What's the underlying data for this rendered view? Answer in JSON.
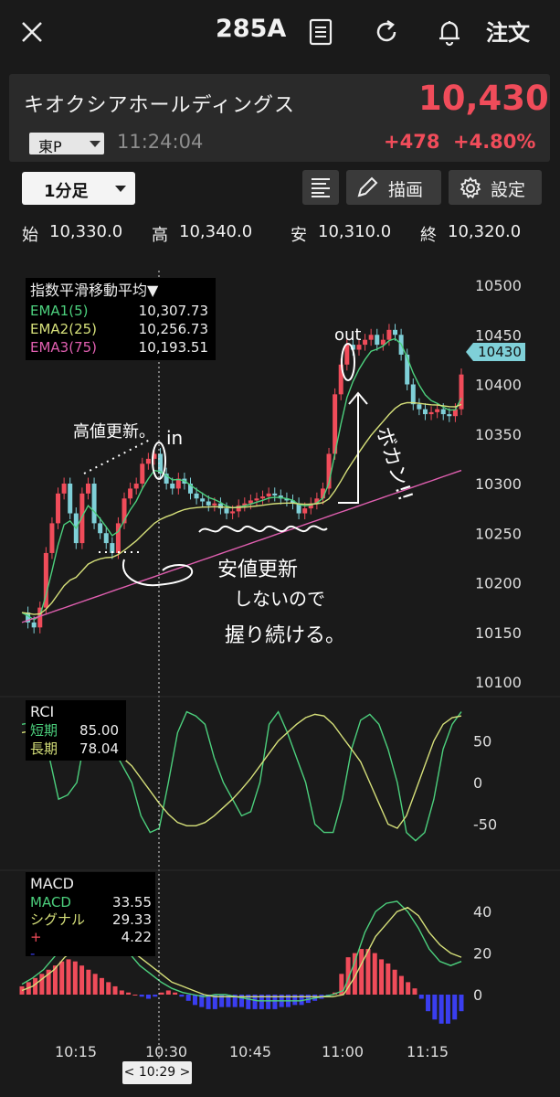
{
  "header": {
    "ticker": "285A",
    "order_label": "注文"
  },
  "quote": {
    "company_name": "キオクシアホールディングス",
    "price": "10,430",
    "market": "東P",
    "time": "11:24:04",
    "change": "+478",
    "change_pct": "+4.80%",
    "up_color": "#f04c5a"
  },
  "toolbar": {
    "period": "1分足",
    "draw_label": "描画",
    "settings_label": "設定"
  },
  "ohlc": {
    "open_label": "始",
    "open": "10,330.0",
    "high_label": "高",
    "high": "10,340.0",
    "low_label": "安",
    "low": "10,310.0",
    "close_label": "終",
    "close": "10,320.0"
  },
  "indicators": {
    "ema_title": "指数平滑移動平均▼",
    "ema1_label": "EMA1(5)",
    "ema1_value": "10,307.73",
    "ema2_label": "EMA2(25)",
    "ema2_value": "10,256.73",
    "ema3_label": "EMA3(75)",
    "ema3_value": "10,193.51",
    "rci_title": "RCI",
    "rci_short_label": "短期",
    "rci_short_value": "85.00",
    "rci_long_label": "長期",
    "rci_long_value": "78.04",
    "macd_title": "MACD",
    "macd_label": "MACD",
    "macd_value": "33.55",
    "signal_label": "シグナル",
    "signal_value": "29.33",
    "hist_plus_label": "+",
    "hist_value": "4.22",
    "hist_minus_label": "-"
  },
  "price_axis": {
    "ticks": [
      "10500",
      "10450",
      "10400",
      "10350",
      "10300",
      "10250",
      "10200",
      "10150",
      "10100"
    ],
    "current_tag": "10430"
  },
  "rci_axis": {
    "ticks": [
      "50",
      "0",
      "-50"
    ]
  },
  "macd_axis": {
    "ticks": [
      "40",
      "20",
      "0"
    ]
  },
  "time_axis": {
    "ticks": [
      "10:15",
      "10:30",
      "10:45",
      "11:00",
      "11:15"
    ],
    "cursor_label": "< 10:29 >"
  },
  "annotations": {
    "high_update": "高値更新。",
    "in": "in",
    "out": "out",
    "bokan": "ボカン!!",
    "note_line1": "安値更新",
    "note_line2": "しないので",
    "note_line3": "握り続ける。"
  },
  "colors": {
    "ema1": "#4cd07d",
    "ema2": "#d6e07a",
    "ema3": "#e05fb0",
    "candle_up": "#f04c5a",
    "candle_down": "#7fd0d8",
    "macd_neg": "#3a3ef0"
  }
}
